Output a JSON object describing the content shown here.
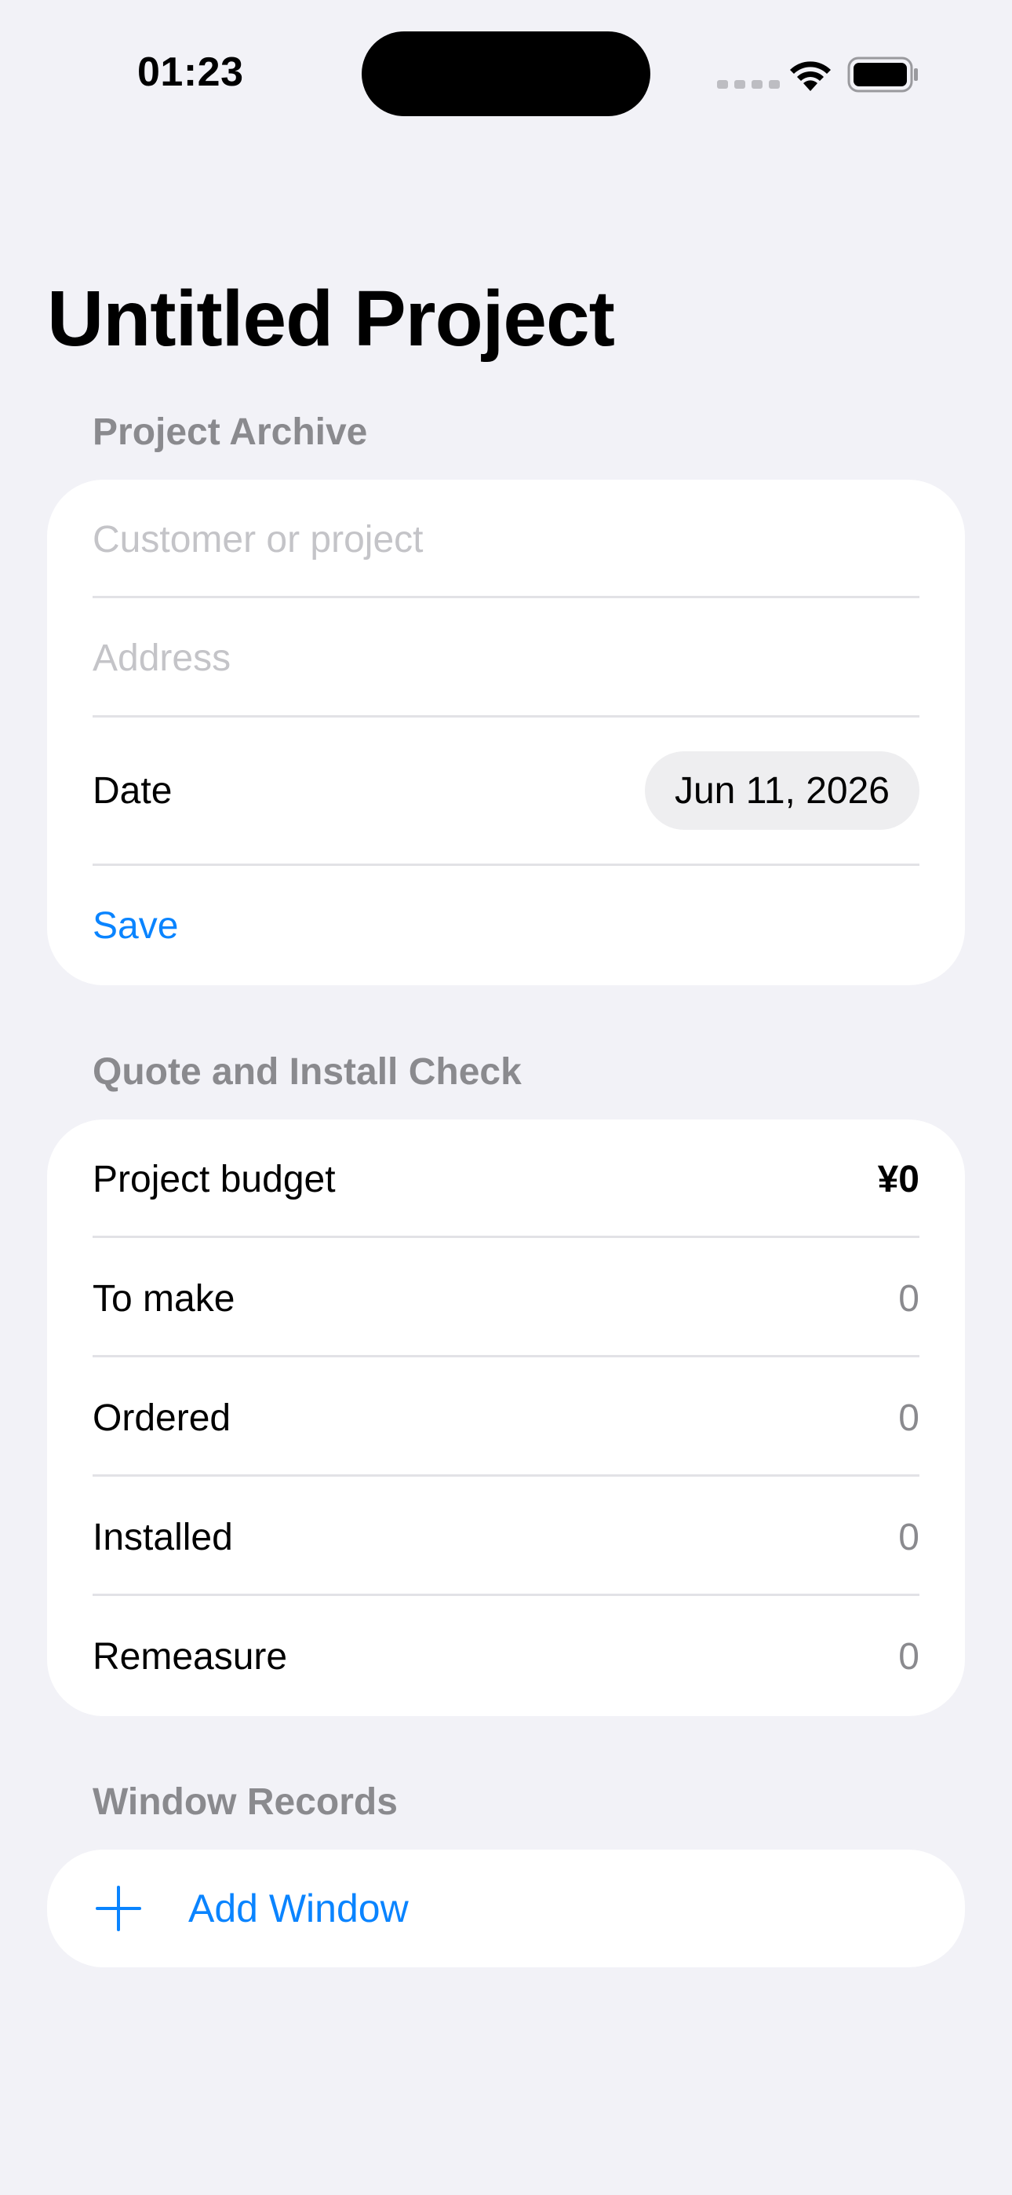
{
  "status_bar": {
    "time": "01:23"
  },
  "page": {
    "title": "Untitled Project"
  },
  "project_archive": {
    "header": "Project Archive",
    "customer_placeholder": "Customer or project",
    "customer_value": "",
    "address_placeholder": "Address",
    "address_value": "",
    "date_label": "Date",
    "date_value": "Jun 11, 2026",
    "save_label": "Save"
  },
  "quote_check": {
    "header": "Quote and Install Check",
    "rows": [
      {
        "label": "Project budget",
        "value": "¥0"
      },
      {
        "label": "To make",
        "value": "0"
      },
      {
        "label": "Ordered",
        "value": "0"
      },
      {
        "label": "Installed",
        "value": "0"
      },
      {
        "label": "Remeasure",
        "value": "0"
      }
    ]
  },
  "window_records": {
    "header": "Window Records",
    "add_label": "Add Window"
  },
  "colors": {
    "background": "#F2F2F7",
    "card": "#FFFFFF",
    "accent": "#0A84FF",
    "secondary_text": "#8A8A8E",
    "placeholder_text": "#C4C4C8"
  },
  "icons": {
    "add": "plus-icon",
    "wifi": "wifi-icon",
    "battery": "battery-icon",
    "cellular": "cellular-signal-icon"
  }
}
